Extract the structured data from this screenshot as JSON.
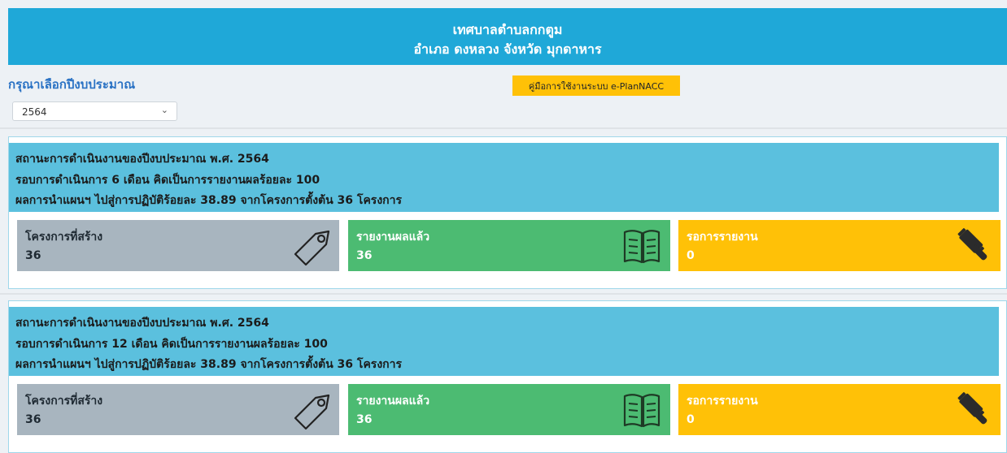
{
  "header": {
    "title": "เทศบาลตำบลกกตูม",
    "subtitle": "อำเภอ ดงหลวง จังหวัด มุกดาหาร"
  },
  "fiscal_year": {
    "label": "กรุณาเลือกปีงบประมาณ",
    "selected": "2564"
  },
  "manual_button": {
    "label": "คู่มือการใช้งานระบบ e-PlanNACC"
  },
  "panels": [
    {
      "line1": "สถานะการดำเนินงานของปีงบประมาณ พ.ศ. 2564",
      "line2": "รอบการดำเนินการ 6 เดือน คิดเป็นการรายงานผลร้อยละ 100",
      "line3": "ผลการนำแผนฯ ไปสู่การปฏิบัติร้อยละ 38.89 จากโครงการตั้งต้น 36 โครงการ",
      "cards": [
        {
          "label": "โครงการที่สร้าง",
          "count": "36",
          "icon": "tag-icon"
        },
        {
          "label": "รายงานผลแล้ว",
          "count": "36",
          "icon": "book-icon"
        },
        {
          "label": "รอการรายงาน",
          "count": "0",
          "icon": "gavel-icon"
        }
      ]
    },
    {
      "line1": "สถานะการดำเนินงานของปีงบประมาณ พ.ศ. 2564",
      "line2": "รอบการดำเนินการ 12 เดือน คิดเป็นการรายงานผลร้อยละ 100",
      "line3": "ผลการนำแผนฯ ไปสู่การปฏิบัติร้อยละ 38.89 จากโครงการตั้งต้น 36 โครงการ",
      "cards": [
        {
          "label": "โครงการที่สร้าง",
          "count": "36",
          "icon": "tag-icon"
        },
        {
          "label": "รายงานผลแล้ว",
          "count": "36",
          "icon": "book-icon"
        },
        {
          "label": "รอการรายงาน",
          "count": "0",
          "icon": "gavel-icon"
        }
      ]
    }
  ],
  "colors": {
    "header": "#1fa8d8",
    "status": "#5bc0de",
    "card_created": "#a8b5bf",
    "card_reported": "#4cbb72",
    "card_pending": "#ffc107"
  }
}
